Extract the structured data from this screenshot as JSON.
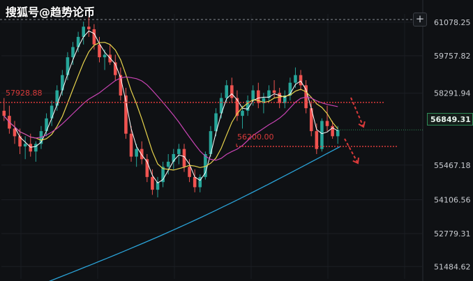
{
  "watermark": "搜狐号@趋势论币",
  "toolbar": {
    "add_label": "+"
  },
  "colors": {
    "up": "#26a69a",
    "down": "#ef5350",
    "ma_fast": "#ffffff",
    "ma_mid": "#e8d44d",
    "ma_slow": "#c944b4",
    "ma_long": "#2aa3d8",
    "level": "#d93a3a",
    "background": "#0f1114"
  },
  "chart_data": {
    "type": "candlestick",
    "y_axis": {
      "position": "right",
      "ticks": [
        "61078.25",
        "59757.82",
        "58291.94",
        "55467.18",
        "54106.56",
        "52779.31",
        "51484.62"
      ],
      "ylim": [
        51000,
        61400
      ]
    },
    "current_price": "56849.31",
    "levels": [
      {
        "label": "57928.88",
        "value": 57928.88,
        "style": "dotted"
      },
      {
        "label": "56200.00",
        "value": 56200.0,
        "style": "dotted"
      }
    ],
    "candles": [
      [
        57600,
        58100,
        57200,
        57400
      ],
      [
        57400,
        57800,
        56700,
        56900
      ],
      [
        56900,
        57200,
        56300,
        56600
      ],
      [
        56600,
        56900,
        55900,
        56200
      ],
      [
        56200,
        56600,
        55700,
        56300
      ],
      [
        56300,
        56700,
        55800,
        56000
      ],
      [
        56000,
        56400,
        55600,
        56300
      ],
      [
        56300,
        57000,
        56100,
        56800
      ],
      [
        56800,
        57500,
        56600,
        57300
      ],
      [
        57300,
        58000,
        57000,
        57800
      ],
      [
        57800,
        58600,
        57600,
        58400
      ],
      [
        58400,
        59200,
        58200,
        59000
      ],
      [
        59000,
        59900,
        58800,
        59700
      ],
      [
        59700,
        60300,
        59400,
        60100
      ],
      [
        60100,
        60700,
        59900,
        60500
      ],
      [
        60500,
        61100,
        60200,
        60900
      ],
      [
        60900,
        61300,
        60500,
        60800
      ],
      [
        60800,
        61000,
        60000,
        60200
      ],
      [
        60200,
        60500,
        59500,
        59700
      ],
      [
        59700,
        60000,
        59200,
        59800
      ],
      [
        59800,
        60200,
        59400,
        59500
      ],
      [
        59500,
        59800,
        58800,
        59000
      ],
      [
        59000,
        59300,
        58000,
        58200
      ],
      [
        58200,
        58500,
        56500,
        56700
      ],
      [
        56700,
        57000,
        55600,
        55800
      ],
      [
        55800,
        56300,
        55400,
        56100
      ],
      [
        56100,
        56400,
        55500,
        55700
      ],
      [
        55700,
        55900,
        54800,
        55000
      ],
      [
        55000,
        55300,
        54300,
        54500
      ],
      [
        54500,
        55000,
        54200,
        54800
      ],
      [
        54800,
        55600,
        54600,
        55400
      ],
      [
        55400,
        55900,
        55100,
        55600
      ],
      [
        55600,
        56100,
        55300,
        55900
      ],
      [
        55900,
        56300,
        55500,
        56100
      ],
      [
        56100,
        56300,
        55200,
        55400
      ],
      [
        55400,
        55700,
        54800,
        55000
      ],
      [
        55000,
        55300,
        54400,
        54600
      ],
      [
        54600,
        55100,
        54400,
        55000
      ],
      [
        55000,
        56000,
        54900,
        55900
      ],
      [
        55900,
        57000,
        55800,
        56800
      ],
      [
        56800,
        57700,
        56600,
        57500
      ],
      [
        57500,
        58300,
        57300,
        58100
      ],
      [
        58100,
        58800,
        57900,
        58600
      ],
      [
        58600,
        58900,
        57900,
        58100
      ],
      [
        58100,
        58400,
        57200,
        57400
      ],
      [
        57400,
        57800,
        56900,
        57600
      ],
      [
        57600,
        58200,
        57400,
        58000
      ],
      [
        58000,
        58600,
        57800,
        58400
      ],
      [
        58400,
        58700,
        57700,
        57900
      ],
      [
        57900,
        58300,
        57500,
        58100
      ],
      [
        58100,
        58600,
        57900,
        58400
      ],
      [
        58400,
        58800,
        58100,
        58300
      ],
      [
        58300,
        58500,
        57700,
        57900
      ],
      [
        57900,
        58400,
        57700,
        58200
      ],
      [
        58200,
        58900,
        58000,
        58700
      ],
      [
        58700,
        59300,
        58500,
        59000
      ],
      [
        59000,
        59200,
        58400,
        58600
      ],
      [
        58600,
        58800,
        57500,
        57700
      ],
      [
        57700,
        58000,
        56600,
        56800
      ],
      [
        56800,
        57100,
        55900,
        56100
      ],
      [
        56100,
        57300,
        56000,
        57200
      ],
      [
        57200,
        57800,
        56800,
        57000
      ],
      [
        57000,
        57200,
        56500,
        56600
      ],
      [
        56600,
        57000,
        56300,
        56849
      ]
    ]
  }
}
